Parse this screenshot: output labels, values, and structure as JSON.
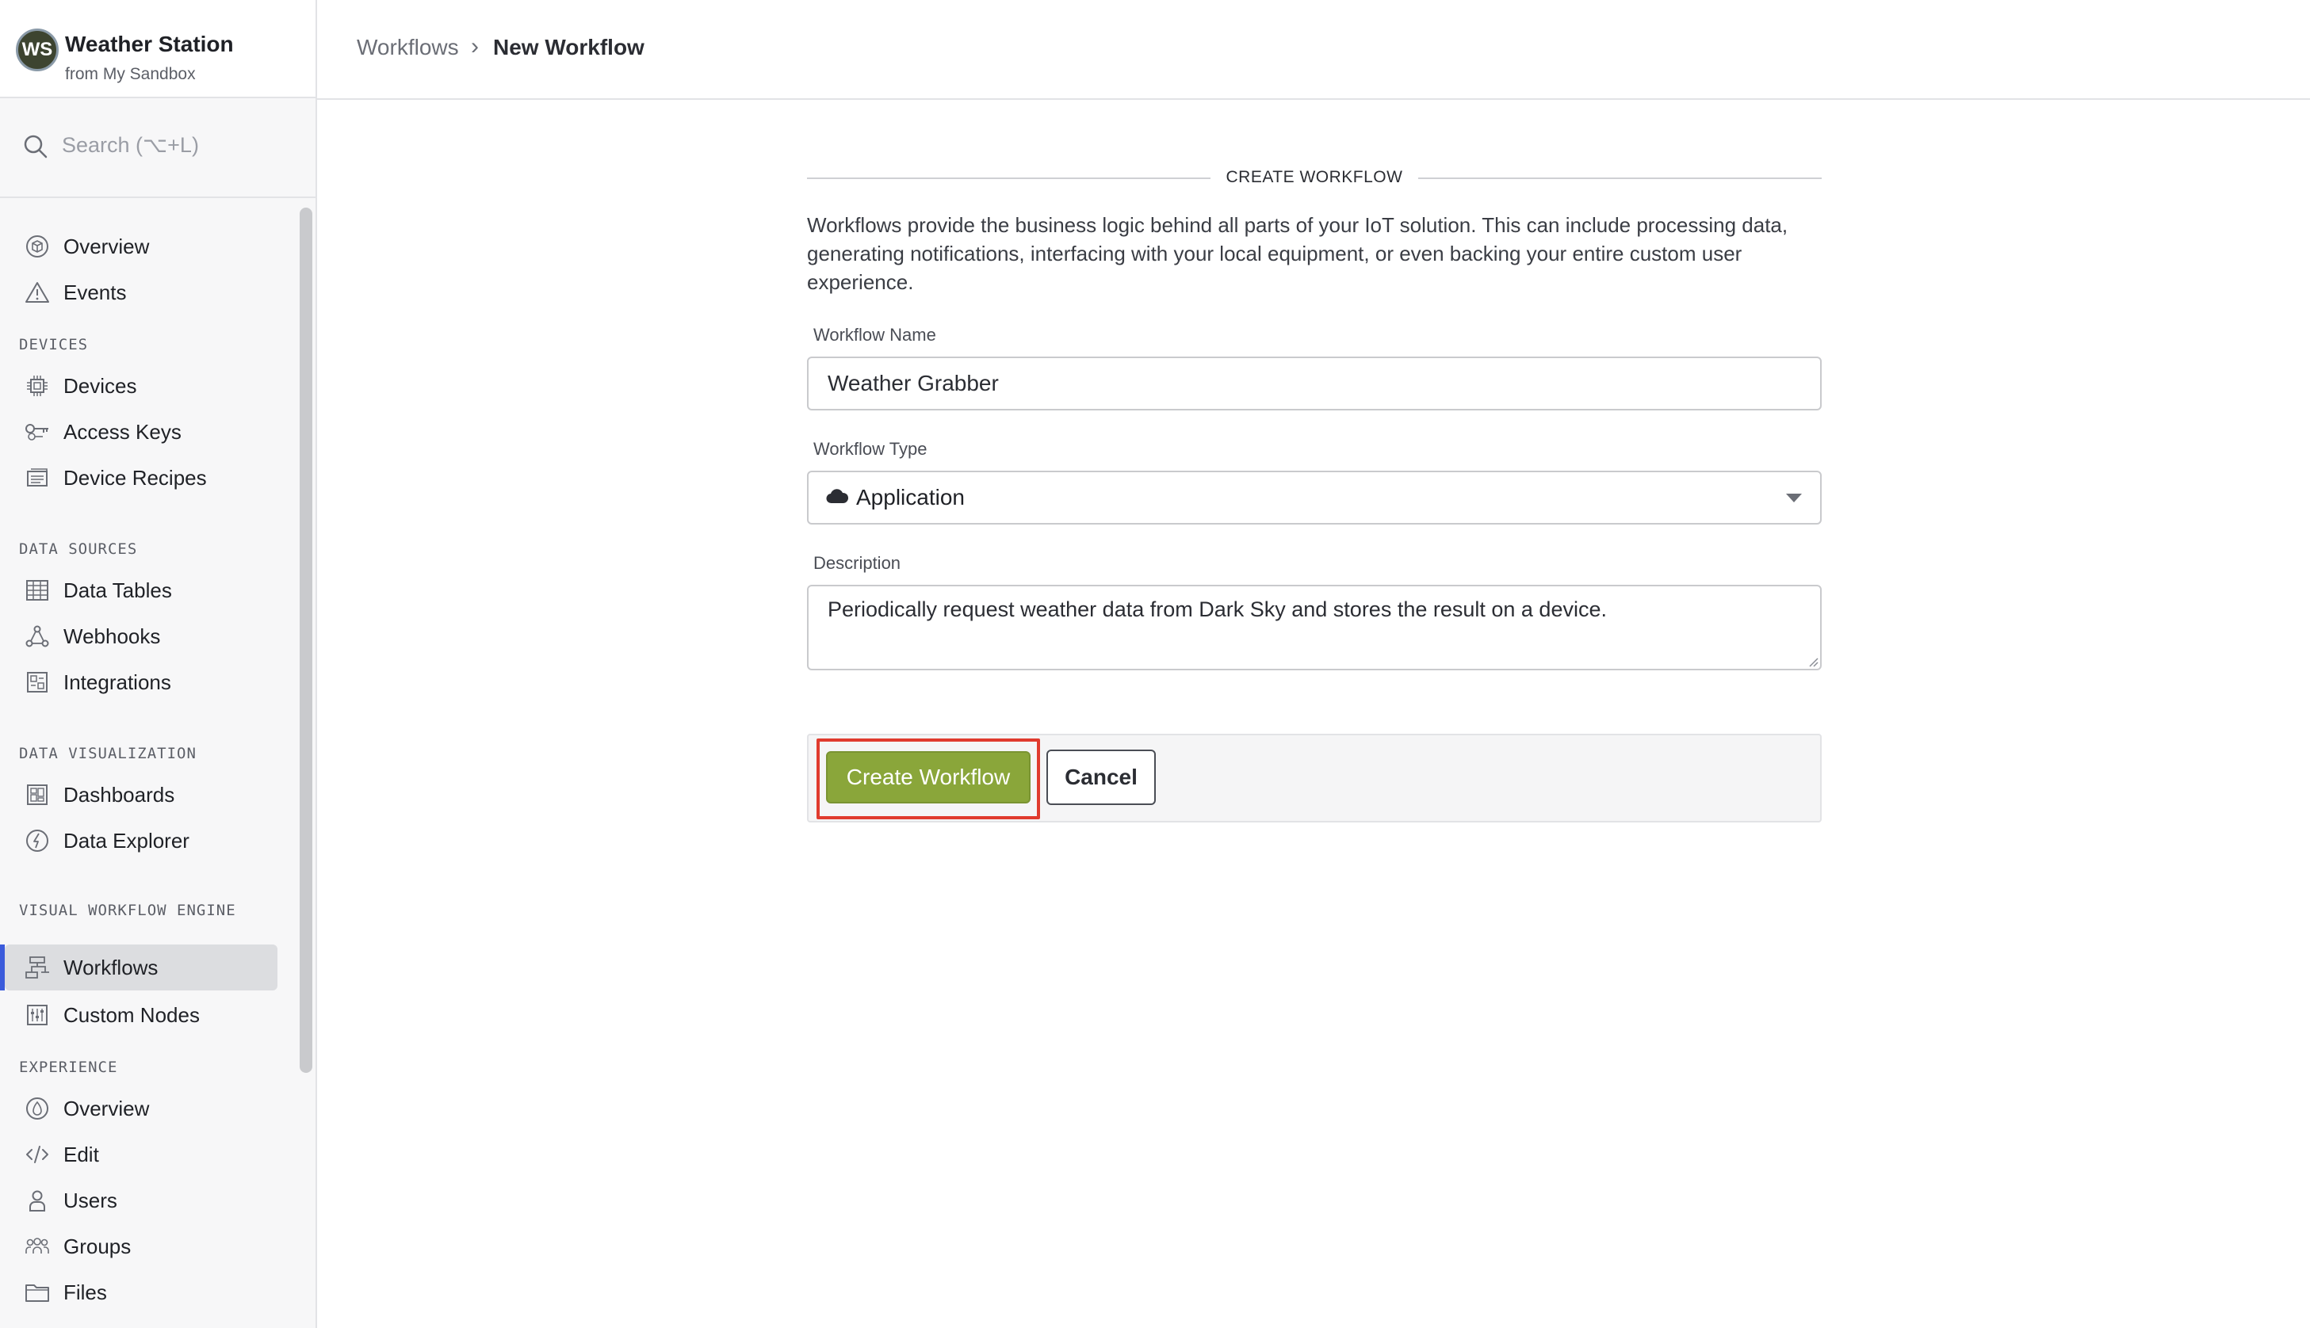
{
  "app": {
    "avatar_initials": "WS",
    "name": "Weather Station",
    "subtitle": "from My Sandbox"
  },
  "search": {
    "placeholder": "Search (⌥+L)",
    "icon": "search-icon"
  },
  "sidebar": {
    "top_items": [
      {
        "label": "Overview",
        "icon": "cube-icon"
      },
      {
        "label": "Events",
        "icon": "warning-icon"
      }
    ],
    "sections": [
      {
        "label": "DEVICES",
        "items": [
          {
            "label": "Devices",
            "icon": "chip-icon"
          },
          {
            "label": "Access Keys",
            "icon": "key-icon"
          },
          {
            "label": "Device Recipes",
            "icon": "recipe-icon"
          }
        ]
      },
      {
        "label": "DATA SOURCES",
        "items": [
          {
            "label": "Data Tables",
            "icon": "table-icon"
          },
          {
            "label": "Webhooks",
            "icon": "webhook-icon"
          },
          {
            "label": "Integrations",
            "icon": "integrations-icon"
          }
        ]
      },
      {
        "label": "DATA VISUALIZATION",
        "items": [
          {
            "label": "Dashboards",
            "icon": "dashboard-icon"
          },
          {
            "label": "Data Explorer",
            "icon": "explorer-icon"
          }
        ]
      },
      {
        "label": "VISUAL WORKFLOW ENGINE",
        "items": [
          {
            "label": "Workflows",
            "icon": "workflow-icon",
            "active": true
          },
          {
            "label": "Custom Nodes",
            "icon": "custom-nodes-icon"
          }
        ]
      },
      {
        "label": "EXPERIENCE",
        "items": [
          {
            "label": "Overview",
            "icon": "experience-overview-icon"
          },
          {
            "label": "Edit",
            "icon": "code-icon"
          },
          {
            "label": "Users",
            "icon": "user-icon"
          },
          {
            "label": "Groups",
            "icon": "groups-icon"
          },
          {
            "label": "Files",
            "icon": "folder-icon"
          }
        ]
      }
    ]
  },
  "breadcrumb": {
    "parent": "Workflows",
    "separator": "›",
    "current": "New Workflow"
  },
  "form": {
    "title": "CREATE WORKFLOW",
    "description": "Workflows provide the business logic behind all parts of your IoT solution. This can include processing data, generating notifications, interfacing with your local equipment, or even backing your entire custom user experience.",
    "name_label": "Workflow Name",
    "name_value": "Weather Grabber",
    "type_label": "Workflow Type",
    "type_value": "Application",
    "type_icon": "cloud-icon",
    "description_label": "Description",
    "description_value": "Periodically request weather data from Dark Sky and stores the result on a device.",
    "create_button": "Create Workflow",
    "cancel_button": "Cancel"
  },
  "colors": {
    "primary_button": "#8aa63a",
    "highlight_outline": "#e03b2e",
    "active_nav_indicator": "#3b5bdb"
  }
}
